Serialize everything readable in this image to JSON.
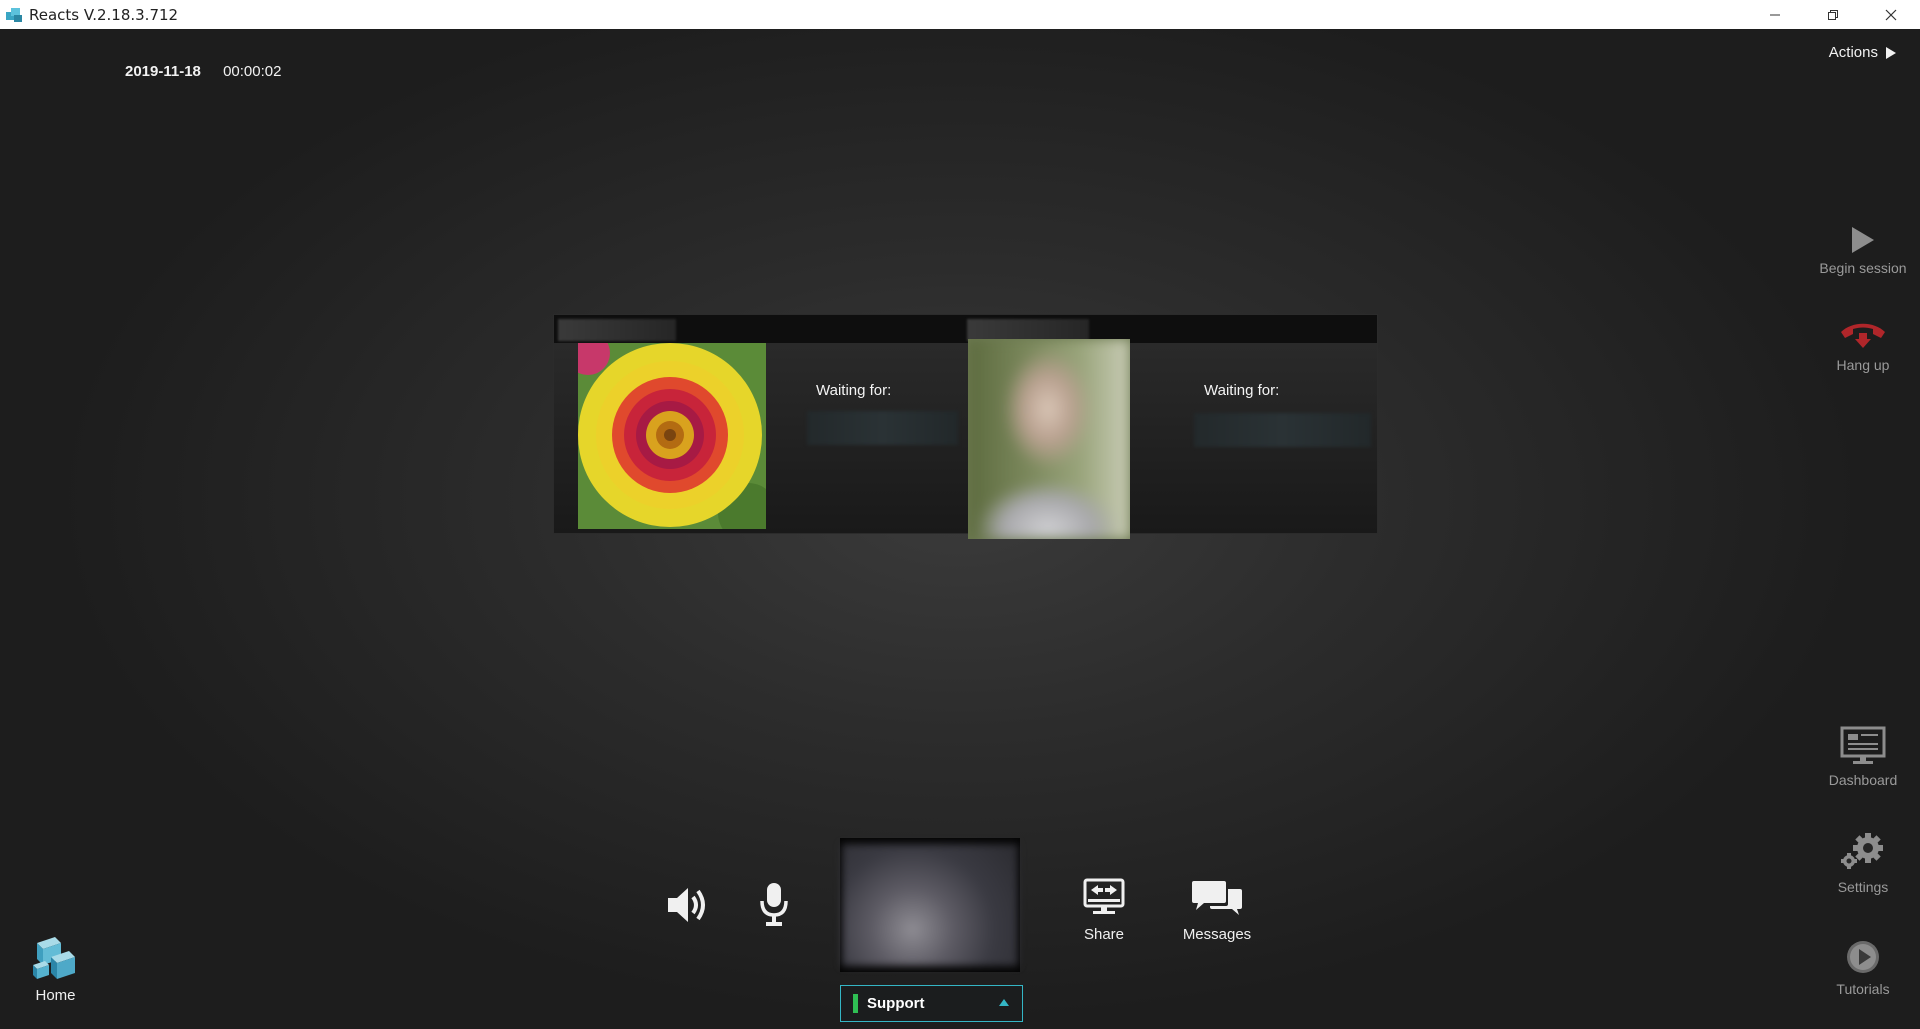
{
  "window": {
    "title": "Reacts V.2.18.3.712",
    "minimize_icon": "minimize-icon",
    "maximize_icon": "restore-icon",
    "close_icon": "close-icon"
  },
  "session": {
    "date": "2019-11-18",
    "timer": "00:00:02"
  },
  "actions": {
    "label": "Actions",
    "icon": "play-triangle-icon"
  },
  "right_rail": {
    "begin_session": "Begin session",
    "hang_up": "Hang up",
    "dashboard": "Dashboard",
    "settings": "Settings",
    "tutorials": "Tutorials"
  },
  "participants": [
    {
      "status": "Waiting for:",
      "avatar": "flower-photo"
    },
    {
      "status": "Waiting for:",
      "avatar": "person-photo-blurred"
    }
  ],
  "toolbar": {
    "share": "Share",
    "messages": "Messages",
    "speaker_icon": "speaker-icon",
    "mic_icon": "microphone-icon"
  },
  "channel": {
    "label": "Support",
    "status_color": "#2fbf54",
    "accent": "#34b6c5"
  },
  "home": {
    "label": "Home"
  },
  "colors": {
    "hangup_red": "#c0282c",
    "rail_text": "#9a9a9a"
  }
}
